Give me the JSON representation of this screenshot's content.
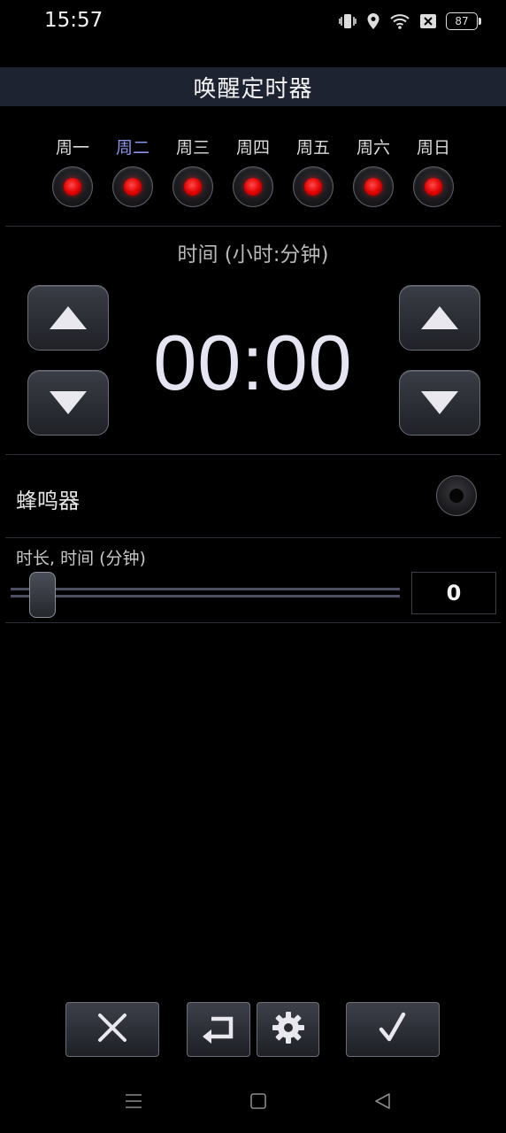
{
  "status": {
    "time": "15:57",
    "battery": "87"
  },
  "title": "唤醒定时器",
  "days": [
    {
      "label": "周一",
      "selected": false
    },
    {
      "label": "周二",
      "selected": true
    },
    {
      "label": "周三",
      "selected": false
    },
    {
      "label": "周四",
      "selected": false
    },
    {
      "label": "周五",
      "selected": false
    },
    {
      "label": "周六",
      "selected": false
    },
    {
      "label": "周日",
      "selected": false
    }
  ],
  "time_section": {
    "caption": "时间 (小时:分钟)",
    "value": "00:00"
  },
  "buzzer": {
    "label": "蜂鸣器"
  },
  "duration": {
    "label": "时长, 时间 (分钟)",
    "value": "0"
  },
  "colors": {
    "accent_selected_day": "#8c95e8",
    "led_red": "#e00000",
    "title_bar_bg": "#1d2330"
  },
  "icons": {
    "cancel": "close-icon",
    "undo": "return-icon",
    "settings": "gear-icon",
    "confirm": "check-icon",
    "nav": [
      "menu-icon",
      "home-icon",
      "back-icon"
    ]
  }
}
